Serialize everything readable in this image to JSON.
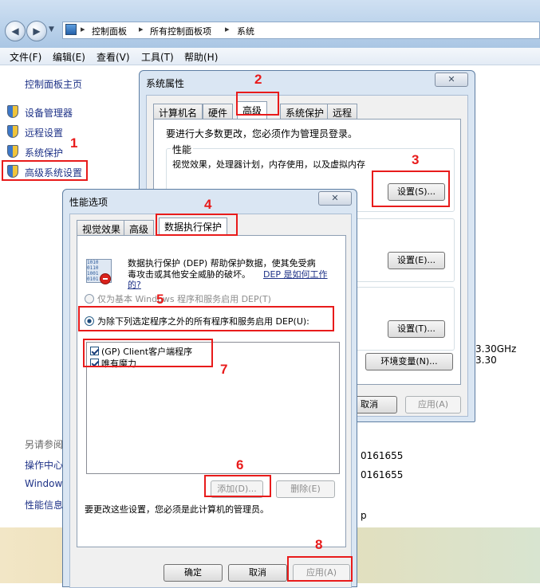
{
  "explorer": {
    "breadcrumbs": [
      "控制面板",
      "所有控制面板项",
      "系统"
    ],
    "menu": [
      "文件(F)",
      "编辑(E)",
      "查看(V)",
      "工具(T)",
      "帮助(H)"
    ]
  },
  "leftnav": {
    "home": "控制面板主页",
    "items": [
      "设备管理器",
      "远程设置",
      "系统保护",
      "高级系统设置"
    ],
    "see_also_title": "另请参阅",
    "see_also": [
      "操作中心",
      "Windows",
      "性能信息"
    ]
  },
  "background_right": {
    "cpu": "3.30GHz   3.30",
    "id1": "0161655",
    "id2": "0161655",
    "suffix": "p"
  },
  "system_properties": {
    "title": "系统属性",
    "tabs": [
      "计算机名",
      "硬件",
      "高级",
      "系统保护",
      "远程"
    ],
    "admin_note": "要进行大多数更改，您必须作为管理员登录。",
    "perf_caption": "性能",
    "perf_desc": "视觉效果，处理器计划，内存使用，以及虚拟内存",
    "settings1": "设置(S)...",
    "settings2": "设置(E)...",
    "settings3": "设置(T)...",
    "env_button": "环境变量(N)...",
    "cancel_fragment": "取消",
    "apply_button": "应用(A)"
  },
  "performance_options": {
    "title": "性能选项",
    "tabs": [
      "视觉效果",
      "高级",
      "数据执行保护"
    ],
    "desc_line1": "数据执行保护 (DEP) 帮助保护数据，使其免受病",
    "desc_line2": "毒攻击或其他安全威胁的破坏。",
    "desc_link1": "DEP 是如何工作",
    "desc_link2": "的?",
    "radio1": "仅为基本 Windows 程序和服务启用 DEP(T)",
    "radio2": "为除下列选定程序之外的所有程序和服务启用 DEP(U):",
    "programs": [
      "(GP) Client客户端程序",
      "唯有魔力"
    ],
    "add_button": "添加(D)...",
    "remove_button": "删除(E)",
    "admin_note": "要更改这些设置，您必须是此计算机的管理员。",
    "ok_button": "确定",
    "cancel_button": "取消",
    "apply_button": "应用(A)"
  },
  "annotations": [
    "1",
    "2",
    "3",
    "4",
    "5",
    "6",
    "7",
    "8"
  ],
  "colors": {
    "annotation": "#e81b1b",
    "link": "#1e3287",
    "dialog_frame": "#dae6f3"
  }
}
